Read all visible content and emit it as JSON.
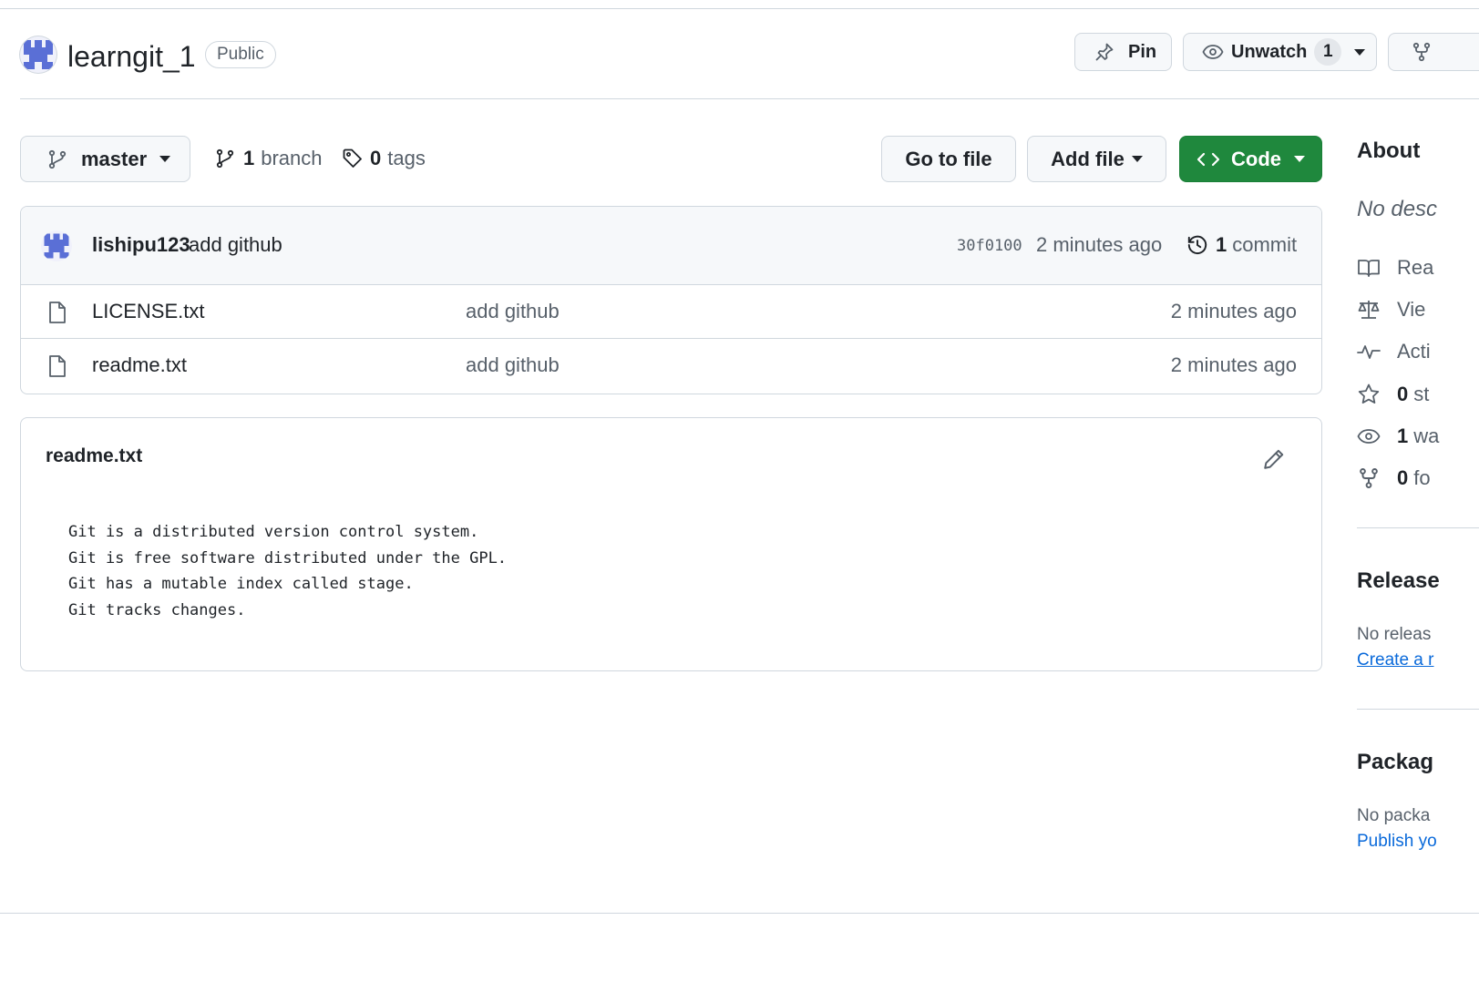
{
  "repo": {
    "name": "learngit_1",
    "visibility": "Public",
    "pin_label": "Pin",
    "unwatch_label": "Unwatch",
    "watch_count": "1"
  },
  "filenav": {
    "branch_name": "master",
    "branches_count": "1",
    "branches_label": "branch",
    "tags_count": "0",
    "tags_label": "tags",
    "go_to_file": "Go to file",
    "add_file": "Add file",
    "code": "Code"
  },
  "latest_commit": {
    "author": "lishipu123",
    "message": "add github",
    "sha": "30f0100",
    "time": "2 minutes ago",
    "count": "1",
    "count_label": "commit"
  },
  "files": [
    {
      "name": "LICENSE.txt",
      "message": "add github",
      "age": "2 minutes ago"
    },
    {
      "name": "readme.txt",
      "message": "add github",
      "age": "2 minutes ago"
    }
  ],
  "readme": {
    "title": "readme.txt",
    "content": "Git is a distributed version control system.\nGit is free software distributed under the GPL.\nGit has a mutable index called stage.\nGit tracks changes."
  },
  "sidebar": {
    "about_title": "About",
    "description": "No desc",
    "readme_label": "Rea",
    "license_label": "Vie",
    "activity_label": "Acti",
    "stars_count": "0",
    "stars_label": "st",
    "watchers_count": "1",
    "watchers_label": "wa",
    "forks_count": "0",
    "forks_label": "fo",
    "releases_title": "Release",
    "releases_note": "No releas",
    "releases_link": "Create a r",
    "packages_title": "Packag",
    "packages_note": "No packa",
    "packages_link": "Publish yo"
  },
  "colors": {
    "primary_button": "#1f883d",
    "link": "#0969da",
    "avatar": "#5a6fd6",
    "border": "#d0d7de"
  },
  "icons": [
    "repo-avatar",
    "pin-icon",
    "eye-icon",
    "fork-icon",
    "git-branch-icon",
    "tag-icon",
    "code-icon",
    "history-icon",
    "file-icon",
    "pencil-icon",
    "book-icon",
    "law-icon",
    "pulse-icon",
    "star-icon",
    "chevron-down-icon"
  ]
}
